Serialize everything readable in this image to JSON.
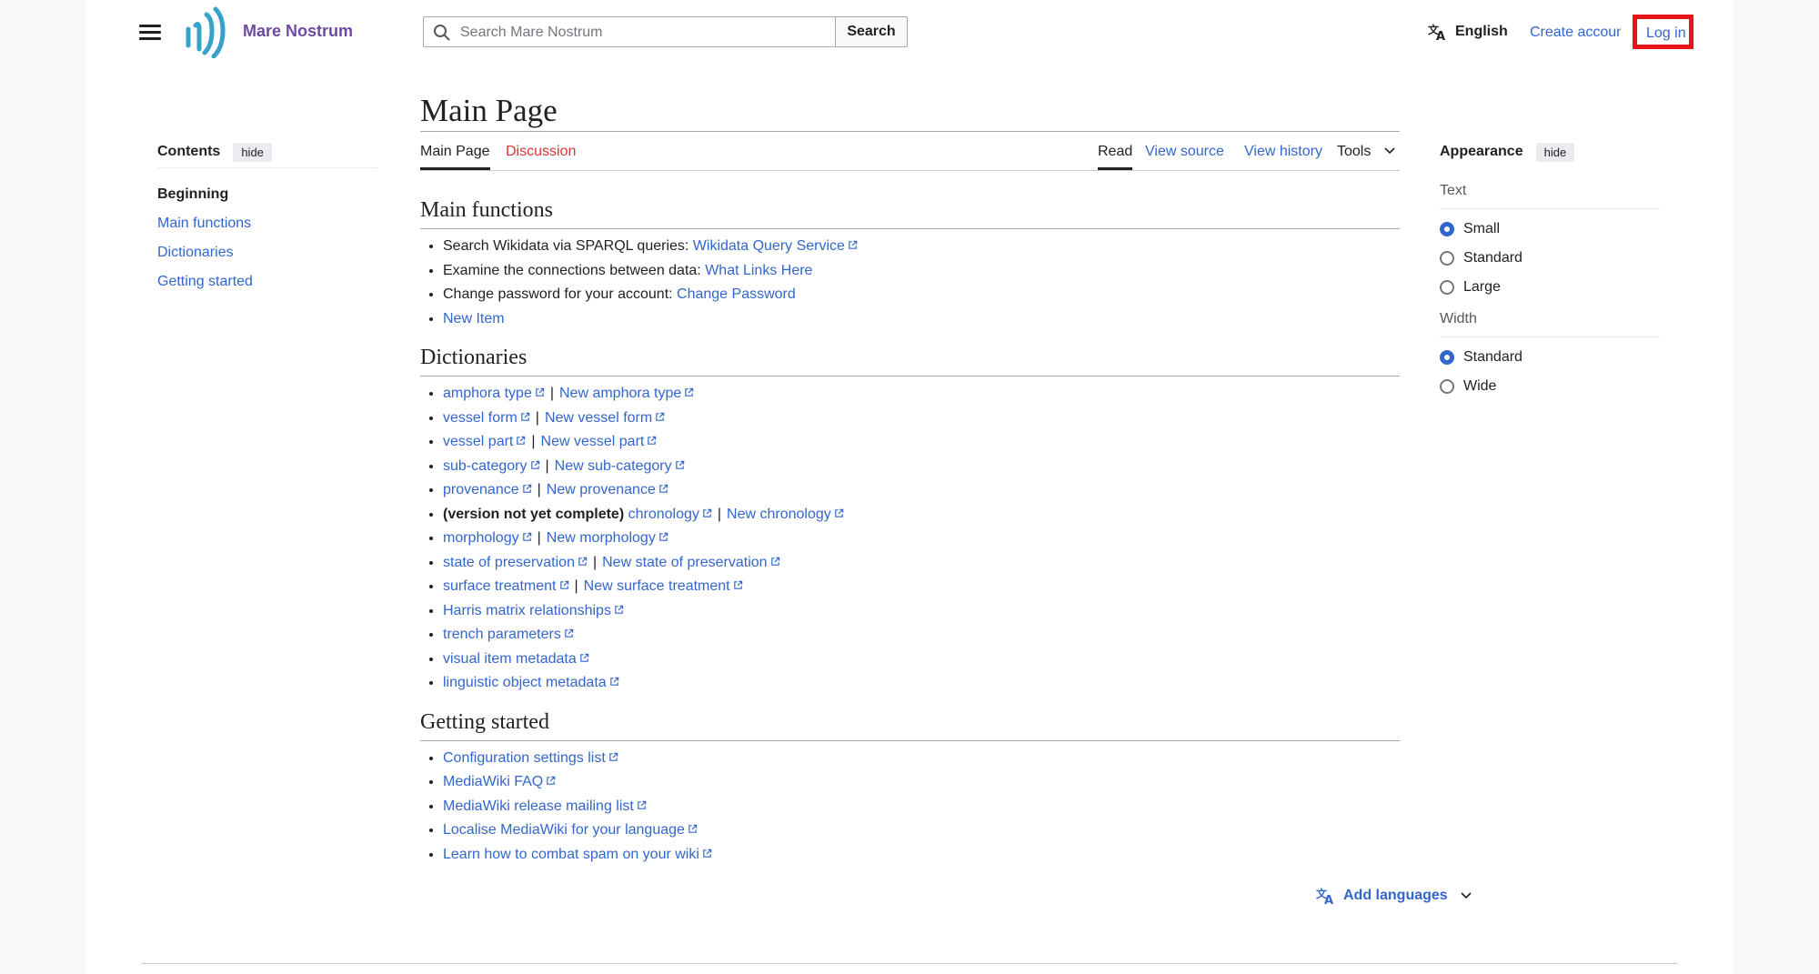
{
  "header": {
    "site_name": "Mare Nostrum",
    "search_placeholder": "Search Mare Nostrum",
    "search_button": "Search",
    "language": "English",
    "create_account": "Create account",
    "login": "Log in"
  },
  "toc": {
    "title": "Contents",
    "hide": "hide",
    "items": [
      "Beginning",
      "Main functions",
      "Dictionaries",
      "Getting started"
    ]
  },
  "page": {
    "title": "Main Page",
    "tabs_left": [
      "Main Page",
      "Discussion"
    ],
    "tabs_right": [
      "Read",
      "View source",
      "View history",
      "Tools"
    ]
  },
  "main_functions": {
    "heading": "Main functions",
    "items": [
      {
        "prefix": "Search Wikidata via SPARQL queries: ",
        "link": "Wikidata Query Service",
        "external": true
      },
      {
        "prefix": "Examine the connections between data: ",
        "link": "What Links Here",
        "external": false
      },
      {
        "prefix": "Change password for your account: ",
        "link": "Change Password",
        "external": false
      },
      {
        "prefix": "",
        "link": "New Item",
        "external": false
      }
    ]
  },
  "dictionaries": {
    "heading": "Dictionaries",
    "note": "(version not yet complete)",
    "items": [
      {
        "a": "amphora type",
        "b": "New amphora type"
      },
      {
        "a": "vessel form",
        "b": "New vessel form"
      },
      {
        "a": "vessel part",
        "b": "New vessel part"
      },
      {
        "a": "sub-category",
        "b": "New sub-category"
      },
      {
        "a": "provenance",
        "b": "New provenance"
      },
      {
        "a": "chronology",
        "b": "New chronology"
      },
      {
        "a": "morphology",
        "b": "New morphology"
      },
      {
        "a": "state of preservation",
        "b": "New state of preservation"
      },
      {
        "a": "surface treatment",
        "b": "New surface treatment"
      },
      {
        "a": "Harris matrix relationships",
        "b": ""
      },
      {
        "a": "trench parameters",
        "b": ""
      },
      {
        "a": "visual item metadata",
        "b": ""
      },
      {
        "a": "linguistic object metadata",
        "b": ""
      }
    ]
  },
  "getting_started": {
    "heading": "Getting started",
    "items": [
      "Configuration settings list",
      "MediaWiki FAQ",
      "MediaWiki release mailing list",
      "Localise MediaWiki for your language",
      "Learn how to combat spam on your wiki"
    ]
  },
  "add_languages": "Add languages",
  "appearance": {
    "title": "Appearance",
    "hide": "hide",
    "text_label": "Text",
    "text_options": [
      "Small",
      "Standard",
      "Large"
    ],
    "text_selected": "Small",
    "width_label": "Width",
    "width_options": [
      "Standard",
      "Wide"
    ],
    "width_selected": "Standard"
  },
  "colors": {
    "link": "#3366cc",
    "redlink": "#dd3333",
    "site_name": "#6b4ba1",
    "logo": "#36a2c9",
    "highlight": "#e8141a"
  }
}
